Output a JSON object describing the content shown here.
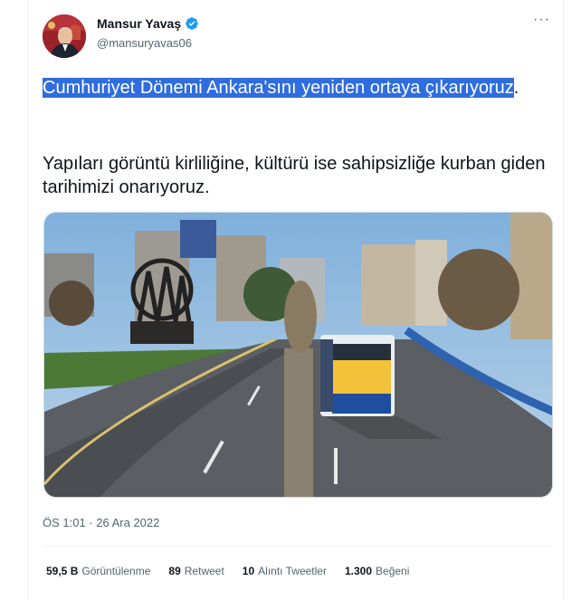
{
  "author": {
    "name": "Mansur Yavaş",
    "handle": "@mansuryavas06",
    "verified_icon": "verified-badge-icon"
  },
  "tweet": {
    "text_highlighted": "Cumhuriyet Dönemi Ankara'sını yeniden ortaya çıkarıyoruz",
    "text_highlight_suffix": ".",
    "text_body": "Yapıları görüntü kirliliğine, kültürü ise sahipsizliğe kurban giden tarihimizi onarıyoruz.",
    "timestamp": "ÖS 1:01 · 26 Ara 2022"
  },
  "stats": {
    "views_value": "59,5 B",
    "views_label": "Görüntülenme",
    "retweets_value": "89",
    "retweets_label": "Retweet",
    "quotes_value": "10",
    "quotes_label": "Alıntı Tweetler",
    "likes_value": "1.300",
    "likes_label": "Beğeni"
  },
  "more_label": "···",
  "colors": {
    "highlight": "#2f6ddf",
    "verified": "#1d9bf0",
    "secondary_text": "#536471"
  }
}
